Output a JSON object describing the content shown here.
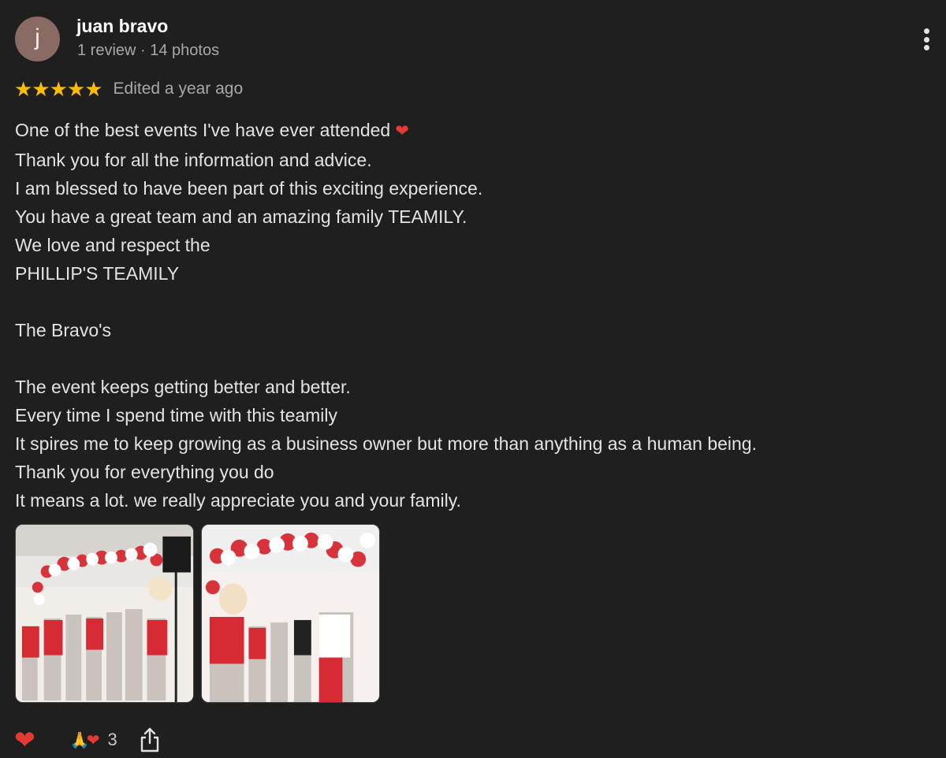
{
  "reviewer": {
    "avatar_letter": "j",
    "name": "juan bravo",
    "meta": "1 review · 14 photos"
  },
  "rating": {
    "stars": "★★★★★",
    "value": 5,
    "edited": "Edited a year ago"
  },
  "review": {
    "lines": [
      "One of the best events I've have ever attended",
      "Thank you for all the information and advice.",
      "I am blessed to have been part of this exciting experience.",
      "You have a great team and an amazing family TEAMILY.",
      "We love and respect the",
      "PHILLIP'S TEAMILY",
      "",
      "The Bravo's",
      "",
      "The event keeps getting better and better.",
      "Every time I spend time with this teamily",
      "It spires me to keep growing as a business owner but more than anything as a human being.",
      "Thank you for everything you do",
      "It means a lot. we really appreciate you and your family."
    ],
    "first_line_emoji": "❤"
  },
  "photos": [
    {
      "icon": "group-photo-1"
    },
    {
      "icon": "group-photo-2"
    }
  ],
  "actions": {
    "like_icon": "❤",
    "reaction_icons": [
      "🙏",
      "❤"
    ],
    "reaction_count": "3",
    "share_icon": "share-icon"
  },
  "colors": {
    "background": "#1f1f1f",
    "star": "#fbbc04",
    "heart": "#e53935",
    "avatar": "#8a6b63"
  }
}
